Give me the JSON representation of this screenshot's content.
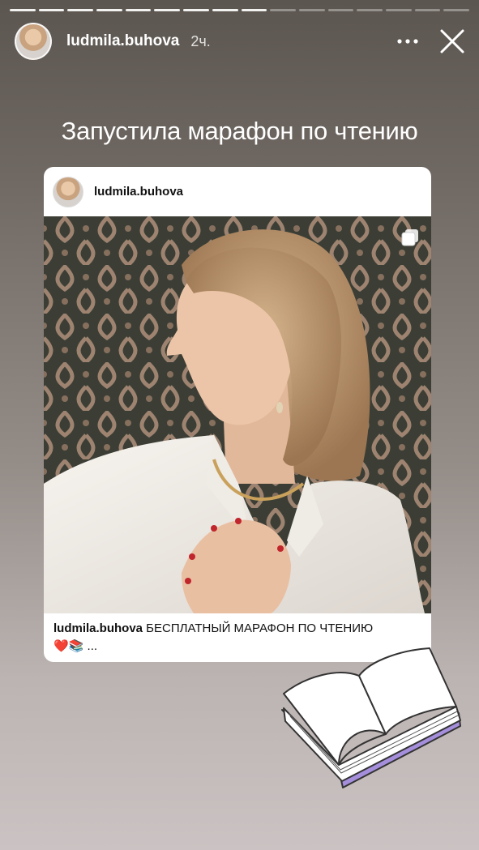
{
  "story": {
    "segments_total": 16,
    "segments_viewed": 9,
    "username": "ludmila.buhova",
    "time": "2ч.",
    "text": "Запустила марафон по чтению"
  },
  "post": {
    "username": "ludmila.buhova",
    "caption_user": "ludmila.buhova",
    "caption_text": " БЕСПЛАТНЫЙ МАРАФОН ПО ЧТЕНИЮ",
    "caption_emoji": "❤️📚",
    "caption_more": "..."
  },
  "icons": {
    "more": "more-icon",
    "close": "close-icon",
    "multi": "multiple-photos-icon",
    "sticker": "open-book-sticker"
  },
  "colors": {
    "book_edge": "#a58fdc",
    "pattern_dark": "#43463d",
    "pattern_light": "#b59782"
  }
}
